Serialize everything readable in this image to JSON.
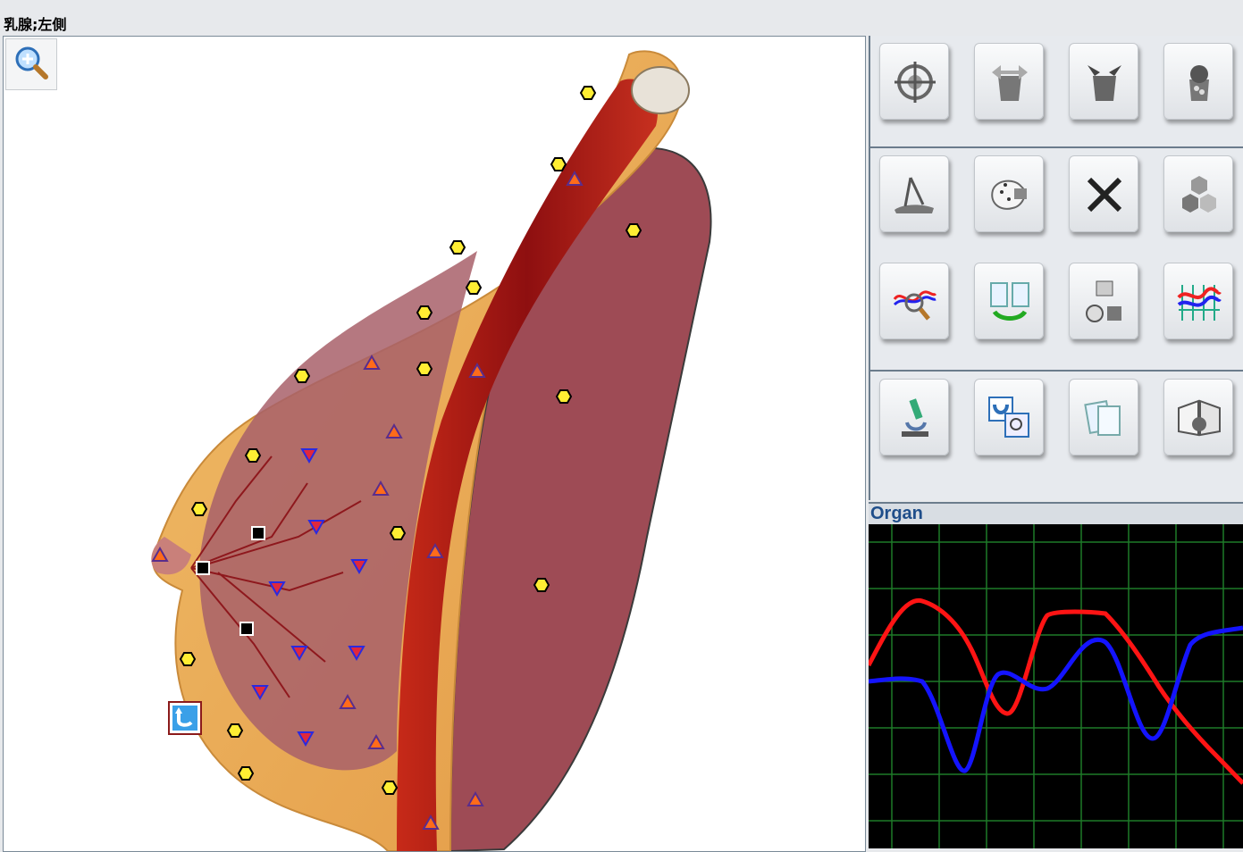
{
  "window": {
    "title": "乳腺;左側"
  },
  "toolbar": {
    "rows": [
      [
        "target-icon",
        "bin-arrows-out-icon",
        "bin-arrows-in-icon",
        "organ-bin-icon"
      ],
      [
        "dissect-tool-icon",
        "organ-points-icon",
        "close-x-icon",
        "hexagon-cells-icon"
      ],
      [
        "wave-magnify-icon",
        "swap-documents-icon",
        "organ-analysis-icon",
        "spectrum-chart-icon"
      ],
      [
        "microscope-icon",
        "compare-magnify-icon",
        "documents-icon",
        "open-book-icon"
      ]
    ]
  },
  "organ_panel": {
    "title": "Organ"
  },
  "colors": {
    "hexagon_fill": "#ffee33",
    "triangle_up_fill": "#ff6b1a",
    "triangle_down_fill": "#e0283c",
    "square_fill": "#000000",
    "graph_grid": "#1e7a28",
    "series_red": "#ff1414",
    "series_blue": "#1414ff"
  }
}
